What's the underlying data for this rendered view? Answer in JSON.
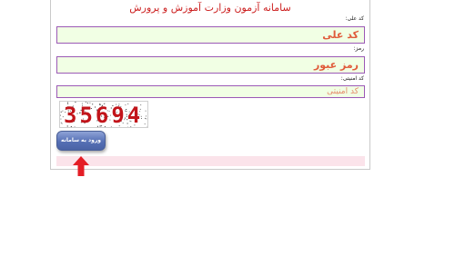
{
  "form": {
    "title": "سامانه آزمون وزارت آموزش و پرورش",
    "fields": {
      "code": {
        "label": "کد علی:",
        "value": "کد علی"
      },
      "password": {
        "label": "رمز:",
        "value": "رمز عبور"
      },
      "security": {
        "label": "کد امنیتی:",
        "placeholder": "کد امنیتی"
      }
    },
    "captcha": {
      "text": "35694"
    },
    "submit_label": "ورود به سامانه"
  },
  "colors": {
    "title": "#cc1f1f",
    "input_bg": "#f1ffe4",
    "input_border": "#9b59b6",
    "input_text": "#e05a3a",
    "button": "#5670b5",
    "message_bar": "#fbe3ea",
    "arrow": "#e41e26",
    "captcha_text": "#c2141a"
  },
  "icons": {
    "pointer": "arrow-up-icon"
  }
}
